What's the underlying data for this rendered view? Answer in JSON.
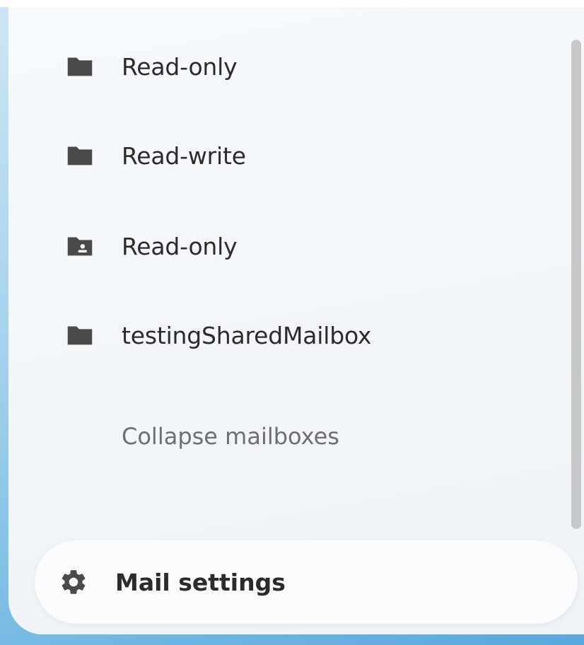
{
  "mailboxes": [
    {
      "label": "Read-only",
      "icon": "folder-icon"
    },
    {
      "label": "Read-write",
      "icon": "folder-icon"
    },
    {
      "label": "Read-only",
      "icon": "shared-folder-icon"
    },
    {
      "label": "testingSharedMailbox",
      "icon": "folder-icon"
    }
  ],
  "collapse_label": "Collapse mailboxes",
  "settings": {
    "label": "Mail settings",
    "icon": "gear-icon"
  },
  "colors": {
    "icon": "#4a4a4a",
    "text": "#2b2b2b",
    "muted_text": "#6d6f71",
    "panel": "#f3f7fa",
    "scrollbar": "#c6c8ca"
  }
}
